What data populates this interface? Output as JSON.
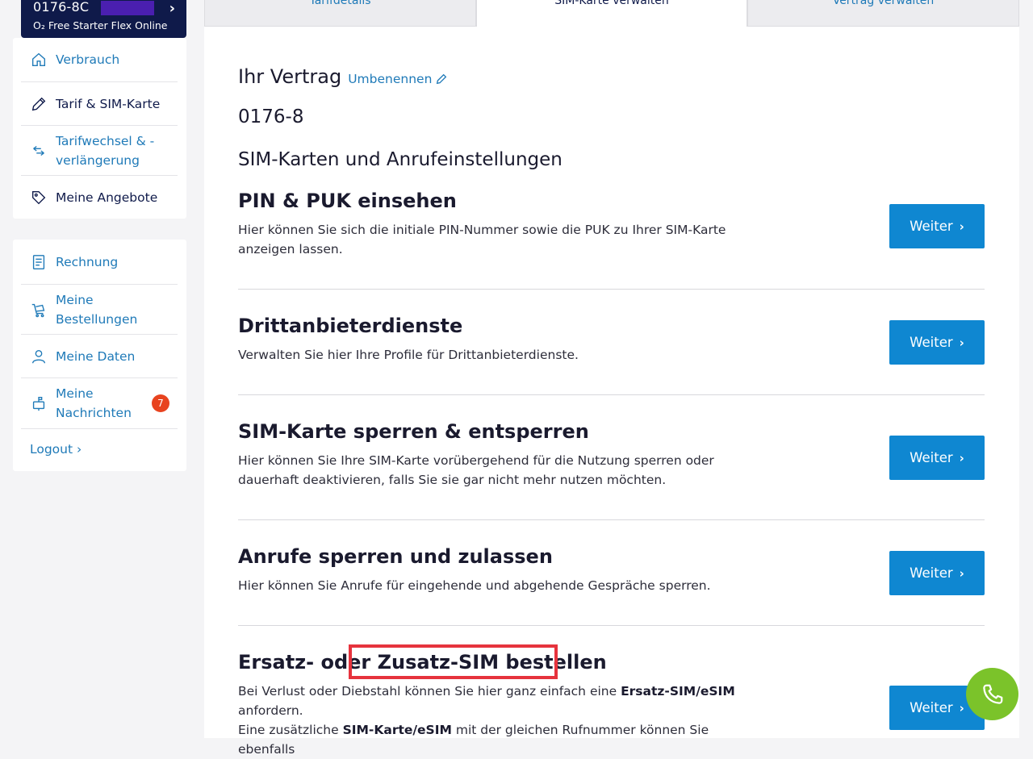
{
  "contract_card": {
    "number": "0176-8C",
    "tariff": "O₂ Free Starter Flex Online"
  },
  "sidebar": {
    "top_items": [
      {
        "label": "Verbrauch",
        "icon": "home-icon"
      },
      {
        "label": "Tarif & SIM-Karte",
        "icon": "pencil-icon"
      },
      {
        "label": "Tarifwechsel & -\nverlängerung",
        "icon": "swap-icon"
      },
      {
        "label": "Meine Angebote",
        "icon": "tag-icon"
      }
    ],
    "bottom_items": [
      {
        "label": "Rechnung",
        "icon": "document-icon"
      },
      {
        "label": "Meine\nBestellungen",
        "icon": "cart-icon"
      },
      {
        "label": "Meine Daten",
        "icon": "user-icon"
      },
      {
        "label": "Meine\nNachrichten",
        "icon": "mailbox-icon",
        "badge": "7"
      }
    ],
    "logout": "Logout ›"
  },
  "tabs": [
    {
      "label": "Tarifdetails",
      "active": false
    },
    {
      "label": "SIM-Karte verwalten",
      "active": true
    },
    {
      "label": "Vertrag verwalten",
      "active": false
    }
  ],
  "main": {
    "contract_title": "Ihr Vertrag",
    "rename_label": "Umbenennen",
    "number": "0176-8",
    "section_title": "SIM-Karten und Anrufeinstellungen",
    "rows": [
      {
        "title": "PIN & PUK einsehen",
        "desc": "Hier können Sie sich die initiale PIN-Nummer sowie die PUK zu Ihrer SIM-Karte anzeigen lassen.",
        "button": "Weiter"
      },
      {
        "title": "Drittanbieterdienste",
        "desc": "Verwalten Sie hier Ihre Profile für Drittanbieterdienste.",
        "button": "Weiter"
      },
      {
        "title": "SIM-Karte sperren & entsperren",
        "desc": "Hier können Sie Ihre SIM-Karte vorübergehend für die Nutzung sperren oder dauerhaft deaktivieren, falls Sie sie gar nicht mehr nutzen möchten.",
        "button": "Weiter"
      },
      {
        "title": "Anrufe sperren und zulassen",
        "desc": "Hier können Sie Anrufe für eingehende und abgehende Gespräche sperren.",
        "button": "Weiter"
      },
      {
        "title_prefix": "Ersatz- oder ",
        "title_highlight": "Zusatz-SIM bestellen",
        "desc_part1": "Bei Verlust oder Diebstahl können Sie hier ganz einfach eine ",
        "desc_bold1": "Ersatz-SIM/eSIM",
        "desc_part2": " anfordern.",
        "desc_part3": "Eine zusätzliche ",
        "desc_bold2": "SIM-Karte/eSIM",
        "desc_part4": " mit der gleichen Rufnummer können Sie ebenfalls",
        "button": "Weiter"
      }
    ]
  },
  "colors": {
    "brand_navy": "#0f1a4a",
    "link_blue": "#1f7ab8",
    "button_blue": "#0f87d1",
    "highlight_red": "#e6333d",
    "badge_red": "#e8431f",
    "fab_green": "#7bc32a"
  },
  "fab": {
    "icon": "phone-icon"
  }
}
